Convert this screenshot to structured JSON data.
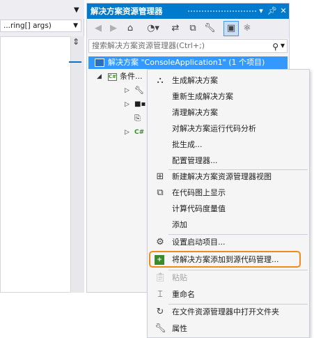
{
  "editor": {
    "member_dropdown": "...ring[] args)"
  },
  "solution_explorer": {
    "title": "解决方案资源管理器",
    "search_placeholder": "搜索解决方案资源管理器(Ctrl+;)",
    "tree": {
      "solution_label": "解决方案 \"ConsoleApplication1\" (1 个项目)",
      "project_label": "条件..."
    },
    "titlebar_buttons": [
      "dropdown-icon",
      "pin-icon",
      "close-icon"
    ],
    "toolbar_icons": [
      "back-icon",
      "forward-icon",
      "home-icon",
      "history-icon",
      "sync-icon",
      "collapse-all-icon",
      "properties-icon",
      "show-all-files-icon",
      "class-view-icon"
    ]
  },
  "context_menu": {
    "items": [
      {
        "label": "生成解决方案",
        "icon": "build-icon",
        "enabled": true
      },
      {
        "label": "重新生成解决方案",
        "icon": "",
        "enabled": true
      },
      {
        "label": "清理解决方案",
        "icon": "",
        "enabled": true
      },
      {
        "label": "对解决方案运行代码分析",
        "icon": "",
        "enabled": true
      },
      {
        "label": "批生成...",
        "icon": "",
        "enabled": true
      },
      {
        "label": "配置管理器...",
        "icon": "",
        "enabled": true
      },
      {
        "label": "新建解决方案资源管理器视图",
        "icon": "new-view-icon",
        "enabled": true
      },
      {
        "label": "在代码图上显示",
        "icon": "code-map-icon",
        "enabled": true
      },
      {
        "label": "计算代码度量值",
        "icon": "",
        "enabled": true
      },
      {
        "label": "添加",
        "icon": "",
        "enabled": true
      },
      {
        "label": "设置启动项目...",
        "icon": "gear-icon",
        "enabled": true
      },
      {
        "label": "将解决方案添加到源代码管理...",
        "icon": "source-control-icon",
        "enabled": true
      },
      {
        "label": "粘贴",
        "icon": "paste-icon",
        "enabled": false
      },
      {
        "label": "重命名",
        "icon": "rename-icon",
        "enabled": true
      },
      {
        "label": "在文件资源管理器中打开文件夹",
        "icon": "open-folder-icon",
        "enabled": true
      },
      {
        "label": "属性",
        "icon": "wrench-icon",
        "enabled": true
      }
    ]
  },
  "colors": {
    "accent": "#007acc",
    "selection": "#3399ff",
    "highlight_box": "#f08b1a"
  }
}
